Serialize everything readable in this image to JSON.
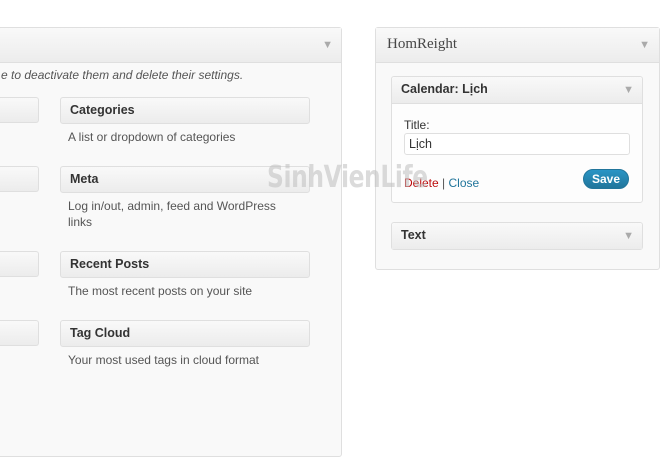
{
  "available": {
    "description": "e to deactivate them and delete their settings.",
    "widgets": [
      {
        "title": "Categories",
        "desc": "A list or dropdown of categories"
      },
      {
        "title": "Meta",
        "desc": "Log in/out, admin, feed and WordPress links"
      },
      {
        "title": "Recent Posts",
        "desc": "The most recent posts on your site"
      },
      {
        "title": "Tag Cloud",
        "desc": "Your most used tags in cloud format"
      }
    ]
  },
  "sidebar": {
    "title": "HomReight",
    "calendar": {
      "title": "Calendar: Lịch",
      "field_label": "Title:",
      "field_value": "Lịch",
      "delete_label": "Delete",
      "separator": "|",
      "close_label": "Close",
      "save_label": "Save"
    },
    "text_widget": {
      "title": "Text"
    }
  },
  "icons": {
    "collapse": "▼"
  },
  "watermark": "SinhVienLife",
  "colors": {
    "save_button": "#21759b",
    "delete_link": "#bc0b0b",
    "close_link": "#21759b"
  }
}
